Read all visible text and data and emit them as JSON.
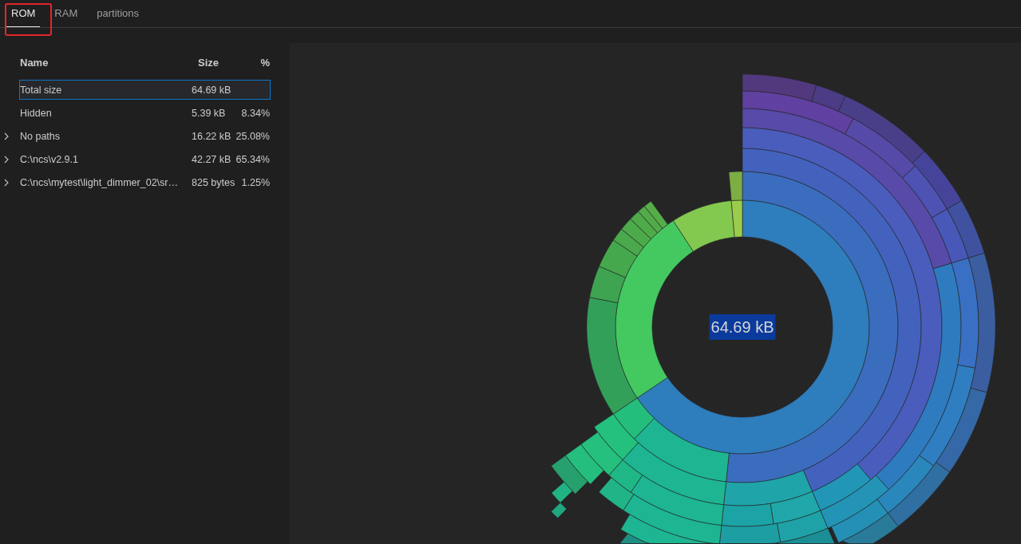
{
  "tabs": [
    {
      "label": "ROM",
      "selected": true,
      "annotated": true
    },
    {
      "label": "RAM",
      "selected": false,
      "annotated": false
    },
    {
      "label": "partitions",
      "selected": false,
      "annotated": false
    }
  ],
  "table": {
    "columns": [
      "Name",
      "Size",
      "%"
    ],
    "rows": [
      {
        "name": "Total size",
        "size": "64.69 kB",
        "selected": true
      },
      {
        "name": "Hidden",
        "size": "5.39 kB",
        "percent": "8.34%",
        "selected": false
      },
      {
        "name": "No paths",
        "size": "16.22 kB",
        "percent": "25.08%",
        "selected": false,
        "expanded": false
      },
      {
        "name": "C:\\ncs\\v2.9.1",
        "size": "42.27 kB",
        "percent": "65.34%",
        "selected": false,
        "expanded": false
      },
      {
        "name": "C:\\ncs\\mytest\\light_dimmer_02\\sr…",
        "size": "825 bytes",
        "percent": "1.25%",
        "selected": false,
        "expanded": false
      }
    ]
  },
  "chart": {
    "center_label": {
      "text": "64.69 kB",
      "highlighted": true
    }
  }
}
